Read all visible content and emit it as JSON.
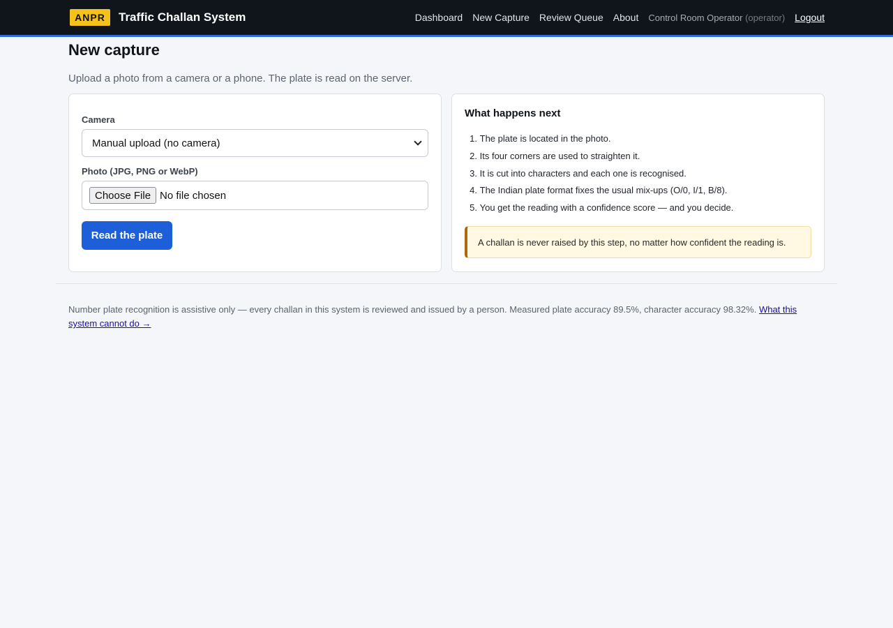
{
  "header": {
    "brand_badge": "ANPR",
    "brand_title": "Traffic Challan System",
    "nav": {
      "dashboard": "Dashboard",
      "new_capture": "New Capture",
      "review_queue": "Review Queue",
      "about": "About"
    },
    "user_name": "Control Room Operator",
    "user_role": "(operator)",
    "logout": "Logout"
  },
  "page": {
    "title": "New capture",
    "subtitle": "Upload a photo from a camera or a phone. The plate is read on the server."
  },
  "form": {
    "camera_label": "Camera",
    "camera_selected": "Manual upload (no camera)",
    "photo_label": "Photo (JPG, PNG or WebP)",
    "file_button": "Choose File",
    "file_status": "No file chosen",
    "submit": "Read the plate"
  },
  "info": {
    "heading": "What happens next",
    "steps": [
      {
        "num": "1.",
        "text": "The plate is located in the photo."
      },
      {
        "num": "2.",
        "text": "Its four corners are used to straighten it."
      },
      {
        "num": "3.",
        "text": "It is cut into characters and each one is recognised."
      },
      {
        "num": "4.",
        "text": "The Indian plate format fixes the usual mix-ups (O/0, I/1, B/8)."
      },
      {
        "num": "5.",
        "text": "You get the reading with a confidence score — and you decide."
      }
    ],
    "notice": "A challan is never raised by this step, no matter how confident the reading is."
  },
  "footer": {
    "text": "Number plate recognition is assistive only — every challan in this system is reviewed and issued by a person. Measured plate accuracy 89.5%, character accuracy 98.32%. ",
    "link": "What this system cannot do →"
  },
  "colors": {
    "topbar": "#10151c",
    "accent": "#2f6fdb",
    "brand_badge": "#f4c21a",
    "primary_button": "#1d5fd8",
    "notice_bg": "#fff8e3",
    "notice_border": "#a86a0a"
  },
  "icons": {
    "select_chevron": "chevron-down-icon"
  }
}
